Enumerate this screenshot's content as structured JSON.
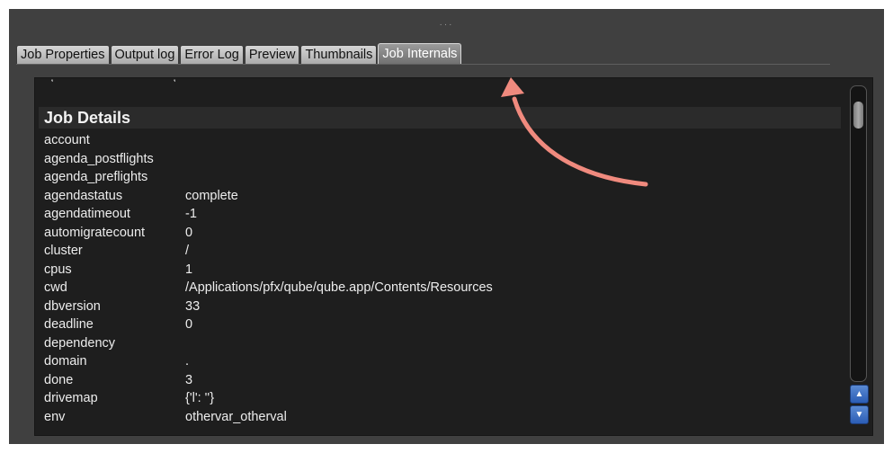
{
  "window": {
    "grip_icon": "drag-handle-dots"
  },
  "tabs": [
    {
      "label": "Job Properties",
      "active": false
    },
    {
      "label": "Output log",
      "active": false
    },
    {
      "label": "Error Log",
      "active": false
    },
    {
      "label": "Preview",
      "active": false
    },
    {
      "label": "Thumbnails",
      "active": false
    },
    {
      "label": "Job Internals",
      "active": true
    }
  ],
  "panel": {
    "section_title": "Job Details",
    "rows": [
      {
        "key": "account",
        "value": ""
      },
      {
        "key": "agenda_postflights",
        "value": ""
      },
      {
        "key": "agenda_preflights",
        "value": ""
      },
      {
        "key": "agendastatus",
        "value": "complete"
      },
      {
        "key": "agendatimeout",
        "value": "-1"
      },
      {
        "key": "automigratecount",
        "value": "0"
      },
      {
        "key": "cluster",
        "value": "/"
      },
      {
        "key": "cpus",
        "value": "1"
      },
      {
        "key": "cwd",
        "value": "/Applications/pfx/qube/qube.app/Contents/Resources"
      },
      {
        "key": "dbversion",
        "value": "33"
      },
      {
        "key": "deadline",
        "value": "0"
      },
      {
        "key": "dependency",
        "value": ""
      },
      {
        "key": "domain",
        "value": "."
      },
      {
        "key": "done",
        "value": "3"
      },
      {
        "key": "drivemap",
        "value": "{'l': ''}"
      },
      {
        "key": "env",
        "value": "othervar_otherval"
      }
    ]
  },
  "scrollbar": {
    "up_icon": "chevron-up-icon",
    "down_icon": "chevron-down-icon",
    "position_fraction": 0.05
  },
  "colors": {
    "window_bg": "#404040",
    "panel_bg": "#1e1e1e",
    "annotation_arrow": "#f08a7e",
    "scroll_button": "#3d6fc6"
  }
}
